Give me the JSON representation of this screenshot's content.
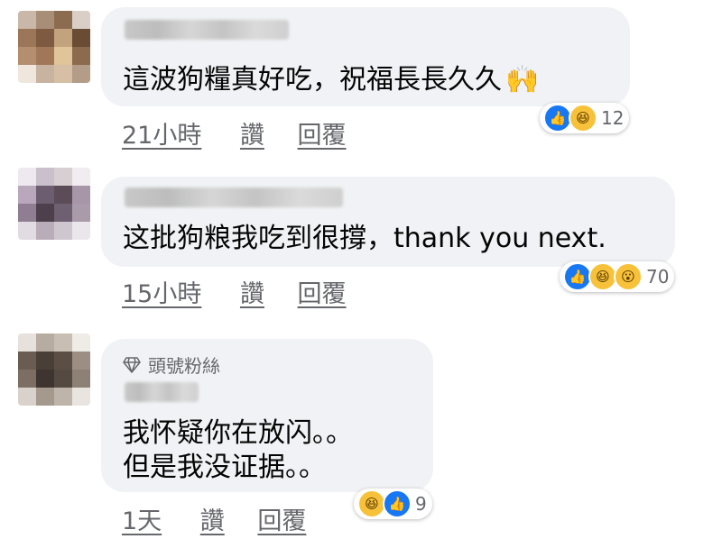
{
  "comments": [
    {
      "text": "這波狗糧真好吃，祝福長長久久",
      "emoji": "🙌",
      "time": "21小時",
      "like": "讚",
      "reply": "回覆",
      "reactions": [
        "like-icon",
        "haha-icon"
      ],
      "reaction_count": "12"
    },
    {
      "text": "这批狗粮我吃到很撐，thank you next.",
      "time": "15小時",
      "like": "讚",
      "reply": "回覆",
      "reactions": [
        "like-icon",
        "haha-icon",
        "wow-icon"
      ],
      "reaction_count": "70"
    },
    {
      "badge": "頭號粉絲",
      "text_line1": "我怀疑你在放闪。。",
      "text_line2": "但是我没证据。。",
      "time": "1天",
      "like": "讚",
      "reply": "回覆",
      "reactions": [
        "haha-icon",
        "like-icon"
      ],
      "reaction_count": "9"
    }
  ],
  "colors": {
    "bubble": "#f0f2f5",
    "meta_text": "#65676b",
    "like_blue": "#1877f2",
    "haha_yellow": "#f7c23a"
  }
}
